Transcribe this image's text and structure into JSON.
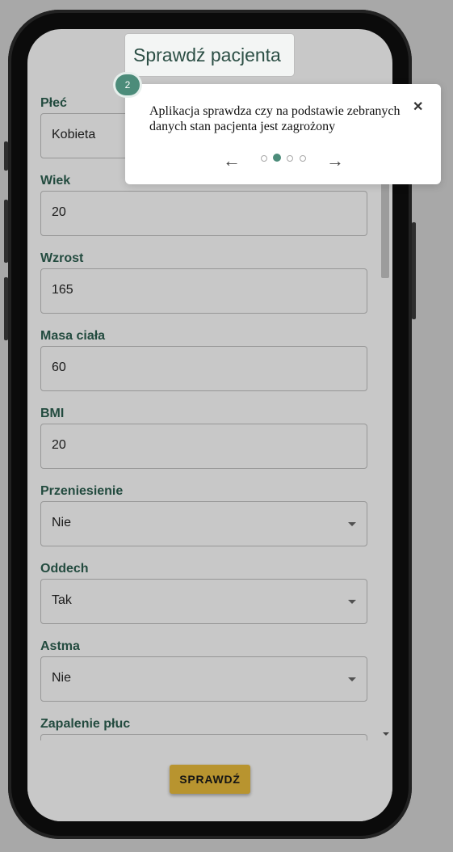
{
  "form": {
    "fields": [
      {
        "label": "Płeć",
        "value": "Kobieta"
      },
      {
        "label": "Wiek",
        "value": "20"
      },
      {
        "label": "Wzrost",
        "value": "165"
      },
      {
        "label": "Masa ciała",
        "value": "60"
      },
      {
        "label": "BMI",
        "value": "20"
      },
      {
        "label": "Przeniesienie",
        "value": "Nie"
      },
      {
        "label": "Oddech",
        "value": "Tak"
      },
      {
        "label": "Astma",
        "value": "Nie"
      },
      {
        "label": "Zapalenie płuc",
        "value": ""
      }
    ]
  },
  "actions": {
    "check_label": "SPRAWDŹ"
  },
  "tour": {
    "highlight_title": "Sprawdź pacjenta",
    "step_number": "2",
    "text": "Aplikacja sprawdza czy na podstawie zebranych danych stan pacjenta jest zagrożony",
    "close_glyph": "✕",
    "prev_glyph": "←",
    "next_glyph": "→",
    "total_steps": 4,
    "active_step": 2
  },
  "colors": {
    "accent": "#4c8c7a",
    "label": "#2c5e4f",
    "button": "#e7b93b"
  }
}
